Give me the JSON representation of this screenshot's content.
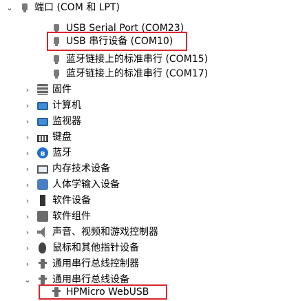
{
  "tree": {
    "ports_group": {
      "label": "端口 (COM 和 LPT)",
      "expand_glyph": "⌄",
      "children": [
        {
          "label": "USB Serial Port (COM23)",
          "icon": "port-plug-icon"
        },
        {
          "label": "USB 串行设备 (COM10)",
          "icon": "port-plug-icon",
          "highlighted": true
        },
        {
          "label": "蓝牙链接上的标准串行 (COM15)",
          "icon": "port-plug-icon"
        },
        {
          "label": "蓝牙链接上的标准串行 (COM17)",
          "icon": "port-plug-icon"
        }
      ]
    },
    "categories": [
      {
        "label": "固件",
        "icon": "firmware-icon",
        "expand_glyph": "›"
      },
      {
        "label": "计算机",
        "icon": "computer-icon",
        "expand_glyph": "›"
      },
      {
        "label": "监视器",
        "icon": "monitor-icon",
        "expand_glyph": "›"
      },
      {
        "label": "键盘",
        "icon": "keyboard-icon",
        "expand_glyph": "›"
      },
      {
        "label": "蓝牙",
        "icon": "bluetooth-icon",
        "expand_glyph": "›"
      },
      {
        "label": "内存技术设备",
        "icon": "memory-tech-icon",
        "expand_glyph": "›"
      },
      {
        "label": "人体学输入设备",
        "icon": "hid-icon",
        "expand_glyph": "›"
      },
      {
        "label": "软件设备",
        "icon": "software-device-icon",
        "expand_glyph": "›"
      },
      {
        "label": "软件组件",
        "icon": "software-component-icon",
        "expand_glyph": "›"
      },
      {
        "label": "声音、视频和游戏控制器",
        "icon": "sound-icon",
        "expand_glyph": "›"
      },
      {
        "label": "鼠标和其他指针设备",
        "icon": "mouse-icon",
        "expand_glyph": "›"
      },
      {
        "label": "通用串行总线控制器",
        "icon": "usb-controller-icon",
        "expand_glyph": "›"
      }
    ],
    "usb_devices_group": {
      "label": "通用串行总线设备",
      "expand_glyph": "⌄",
      "children": [
        {
          "label": "HPMicro WebUSB",
          "icon": "usb-device-icon",
          "highlighted": true
        }
      ]
    }
  },
  "colors": {
    "highlight_border": "#d6262f",
    "text": "#000000",
    "background": "#ffffff"
  }
}
